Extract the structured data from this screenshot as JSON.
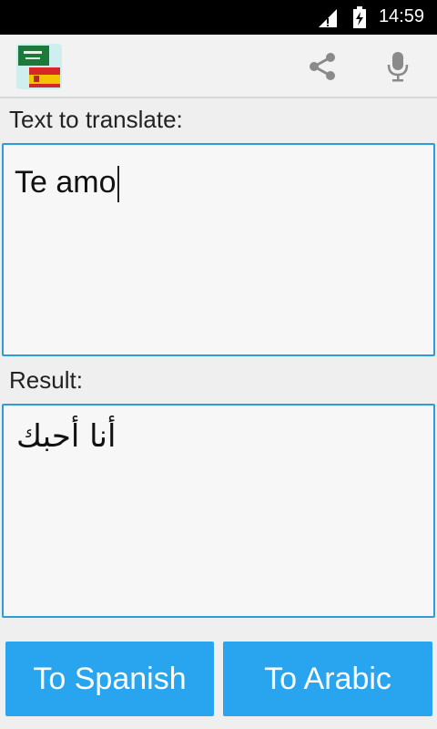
{
  "status_bar": {
    "time": "14:59"
  },
  "action_bar": {
    "logo_icon": "saudi-spain-flags-icon",
    "share_icon": "share-icon",
    "mic_icon": "microphone-icon"
  },
  "source": {
    "label": "Text to translate:",
    "value": "Te amo"
  },
  "result": {
    "label": "Result:",
    "value": "أنا أحبك"
  },
  "buttons": {
    "to_spanish": "To Spanish",
    "to_arabic": "To Arabic"
  },
  "colors": {
    "accent": "#29a4ee",
    "border": "#2d9cdb"
  }
}
